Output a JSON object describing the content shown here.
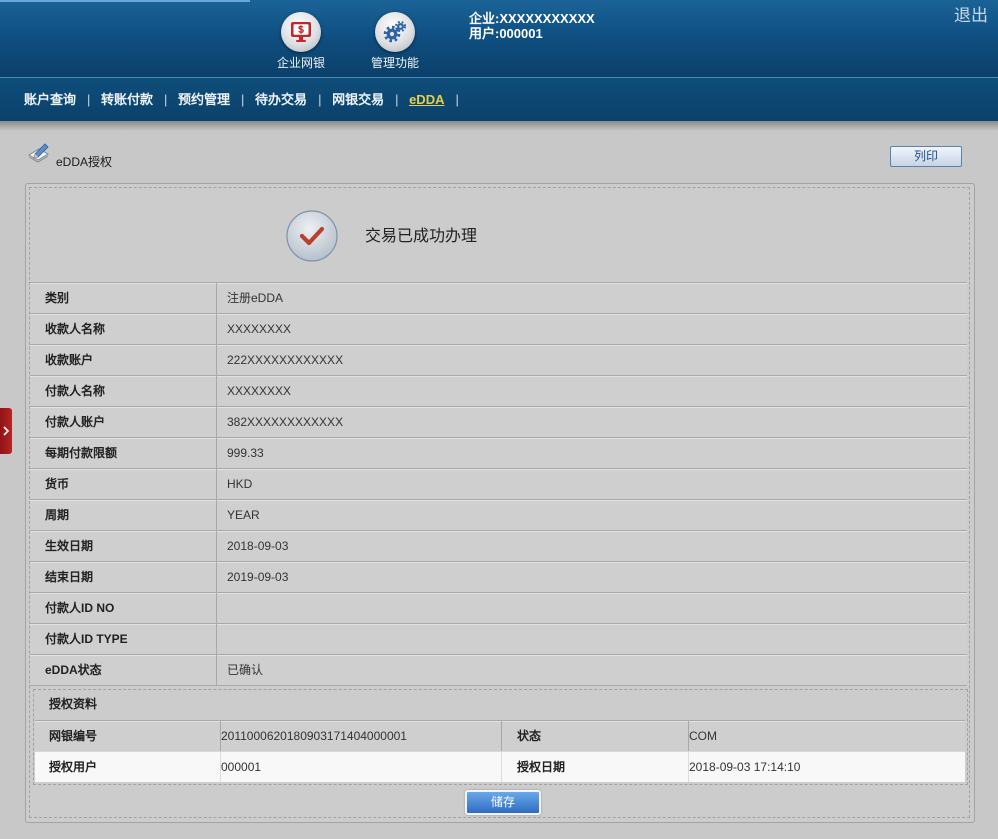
{
  "header": {
    "modules": [
      {
        "label": "企业网银",
        "icon": "monitor-dollar-icon"
      },
      {
        "label": "管理功能",
        "icon": "gears-icon"
      }
    ],
    "company": "企业:XXXXXXXXXXX",
    "user": "用户:000001",
    "logout": "退出"
  },
  "nav": {
    "items": [
      "账户查询",
      "转账付款",
      "预约管理",
      "待办交易",
      "网银交易",
      "eDDA"
    ],
    "active_index": 5,
    "separator": "|"
  },
  "page": {
    "title": "eDDA授权",
    "title_icon": "pencil-edit-icon",
    "print_button": "列印"
  },
  "result": {
    "icon": "check-circle-icon",
    "message": "交易已成功办理"
  },
  "details": [
    {
      "label": "类别",
      "value": "注册eDDA"
    },
    {
      "label": "收款人名称",
      "value": "XXXXXXXX"
    },
    {
      "label": "收款账户",
      "value": "222XXXXXXXXXXXX"
    },
    {
      "label": "付款人名称",
      "value": "XXXXXXXX"
    },
    {
      "label": "付款人账户",
      "value": "382XXXXXXXXXXXX"
    },
    {
      "label": "每期付款限额",
      "value": "999.33"
    },
    {
      "label": "货币",
      "value": "HKD"
    },
    {
      "label": "周期",
      "value": "YEAR"
    },
    {
      "label": "生效日期",
      "value": "2018-09-03"
    },
    {
      "label": "结束日期",
      "value": "2019-09-03"
    },
    {
      "label": "付款人ID NO",
      "value": ""
    },
    {
      "label": "付款人ID TYPE",
      "value": ""
    },
    {
      "label": "eDDA状态",
      "value": "已确认"
    }
  ],
  "auth": {
    "title": "授权资料",
    "rows": [
      {
        "label1": "网银编号",
        "value1": "2011000620180903171404000001",
        "label2": "状态",
        "value2": "COM"
      },
      {
        "label1": "授权用户",
        "value1": "000001",
        "label2": "授权日期",
        "value2": "2018-09-03 17:14:10"
      }
    ]
  },
  "actions": {
    "save_button": "储存"
  },
  "side_tab_icon": "chevron-right-icon",
  "colors": {
    "header": "#0f4e80",
    "nav": "#0a426b",
    "active_nav": "#e6d04a",
    "background": "#c8c8c8",
    "save_button": "#2f6cc0",
    "side_tab": "#a61c1c",
    "check": "#b8402c"
  }
}
